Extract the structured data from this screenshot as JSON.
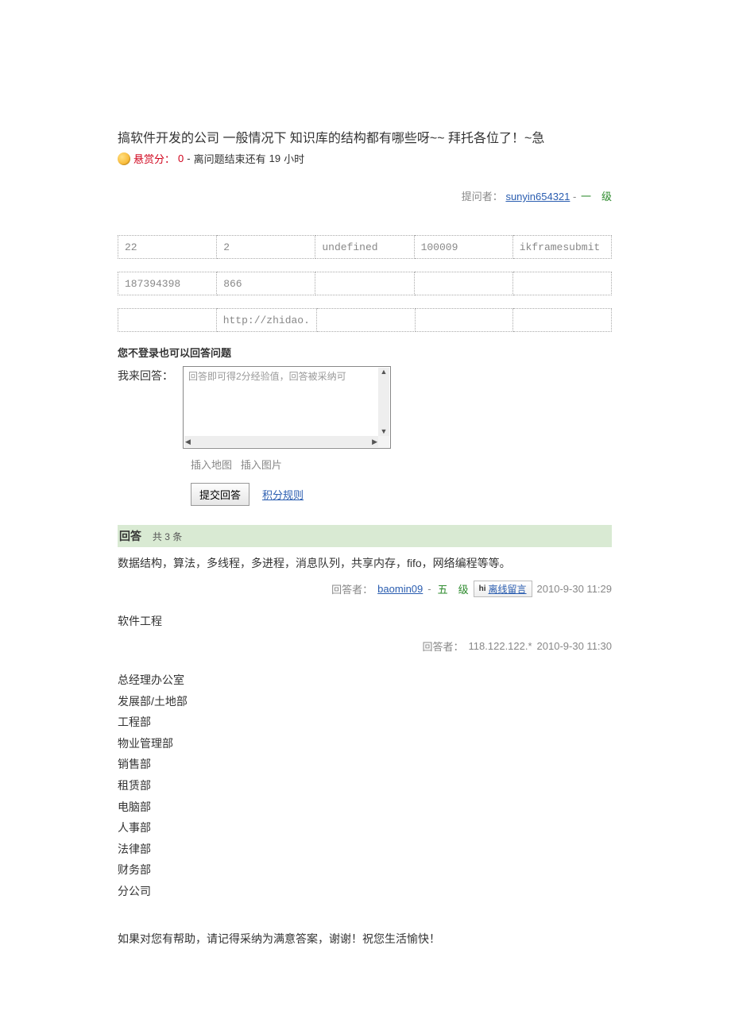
{
  "question": {
    "title": "搞软件开发的公司 一般情况下 知识库的结构都有哪些呀~~ 拜托各位了！~急",
    "reward_label": "悬赏分：",
    "reward_value": "0",
    "sep": " - ",
    "time_left_prefix": "离问题结束还有 ",
    "time_left_value": "19",
    "time_left_suffix": " 小时",
    "asker_label": "提问者：",
    "asker_name": "sunyin654321",
    "asker_level": "一　级"
  },
  "tables": {
    "row1": [
      "22",
      "2",
      "undefined",
      "100009",
      "ikframesubmit"
    ],
    "row2": [
      "187394398",
      "866",
      "",
      "",
      ""
    ],
    "row3": [
      "",
      "http://zhidao.",
      "",
      "",
      ""
    ]
  },
  "answer_box": {
    "login_note": "您不登录也可以回答问题",
    "i_answer": "我来回答：",
    "placeholder": "回答即可得2分经验值，回答被采纳可",
    "insert_map": "插入地图",
    "insert_pic": "插入图片",
    "submit": "提交回答",
    "rules": "积分规则"
  },
  "answers_header": {
    "title": "回答",
    "count_text": "共 3 条"
  },
  "answers": [
    {
      "body": "数据结构，算法，多线程，多进程，消息队列，共享内存，fifo，网络编程等等。",
      "meta_label": "回答者：",
      "user": "baomin09",
      "level": "五　级",
      "offline_msg": "离线留言",
      "time": "2010-9-30 11:29"
    },
    {
      "body": "软件工程",
      "meta_label": "回答者：",
      "ip": "118.122.122.*",
      "time": "2010-9-30 11:30"
    }
  ],
  "departments": [
    "总经理办公室",
    "发展部/土地部",
    "工程部",
    "物业管理部",
    "销售部",
    "租赁部",
    "电脑部",
    "人事部",
    "法律部",
    "财务部",
    "分公司"
  ],
  "closing": "如果对您有帮助，请记得采纳为满意答案，谢谢！祝您生活愉快！"
}
